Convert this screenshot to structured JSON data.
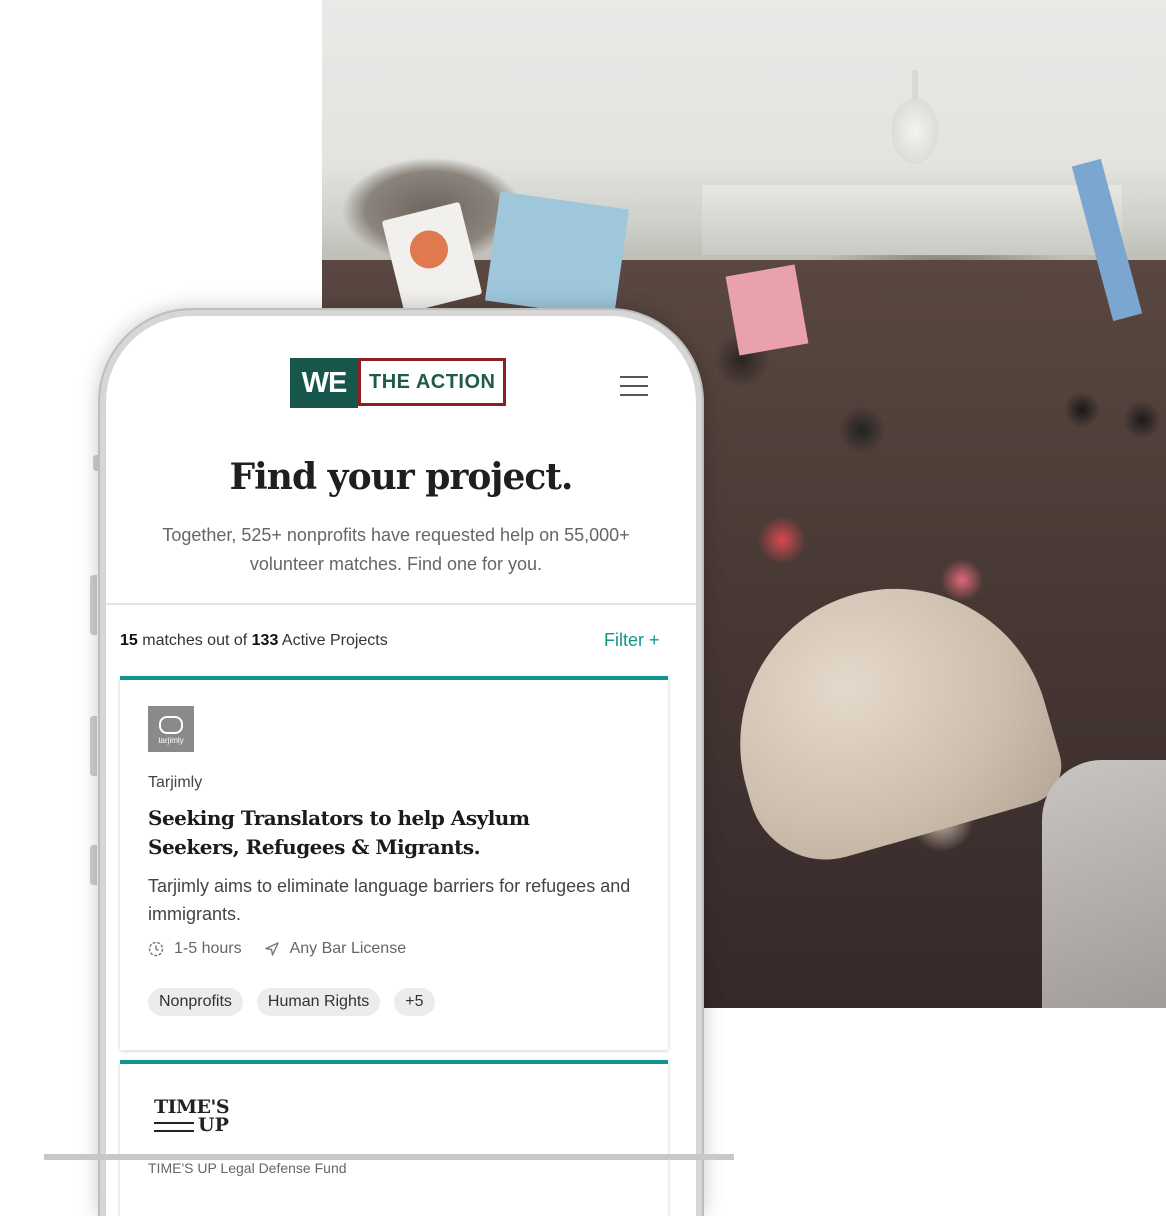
{
  "app": {
    "logo_we": "WE",
    "logo_action": "THE ACTION"
  },
  "hero": {
    "title": "Find your project.",
    "subtitle": "Together, 525+ nonprofits have requested help on 55,000+ volunteer matches. Find one for you."
  },
  "results": {
    "match_count": "15",
    "matches_text": "matches out of",
    "total_count": "133",
    "total_text": "Active Projects",
    "filter_label": "Filter +"
  },
  "projects": [
    {
      "org_logo_text": "tarjimly",
      "org_name": "Tarjimly",
      "title": "Seeking Translators to help Asylum Seekers, Refugees & Migrants.",
      "description": "Tarjimly aims to eliminate language barriers for refugees and immigrants.",
      "time": "1-5 hours",
      "license": "Any Bar License",
      "tags": [
        "Nonprofits",
        "Human Rights",
        "+5"
      ]
    },
    {
      "org_logo_line1": "TIME'S",
      "org_logo_line2": "UP",
      "org_name_partial": "TIME'S UP Legal Defense Fund"
    }
  ],
  "colors": {
    "brand_green": "#17564a",
    "brand_red": "#8c1f26",
    "accent_teal": "#11958a"
  },
  "icons": [
    "menu-icon",
    "clock-icon",
    "location-arrow-icon"
  ]
}
